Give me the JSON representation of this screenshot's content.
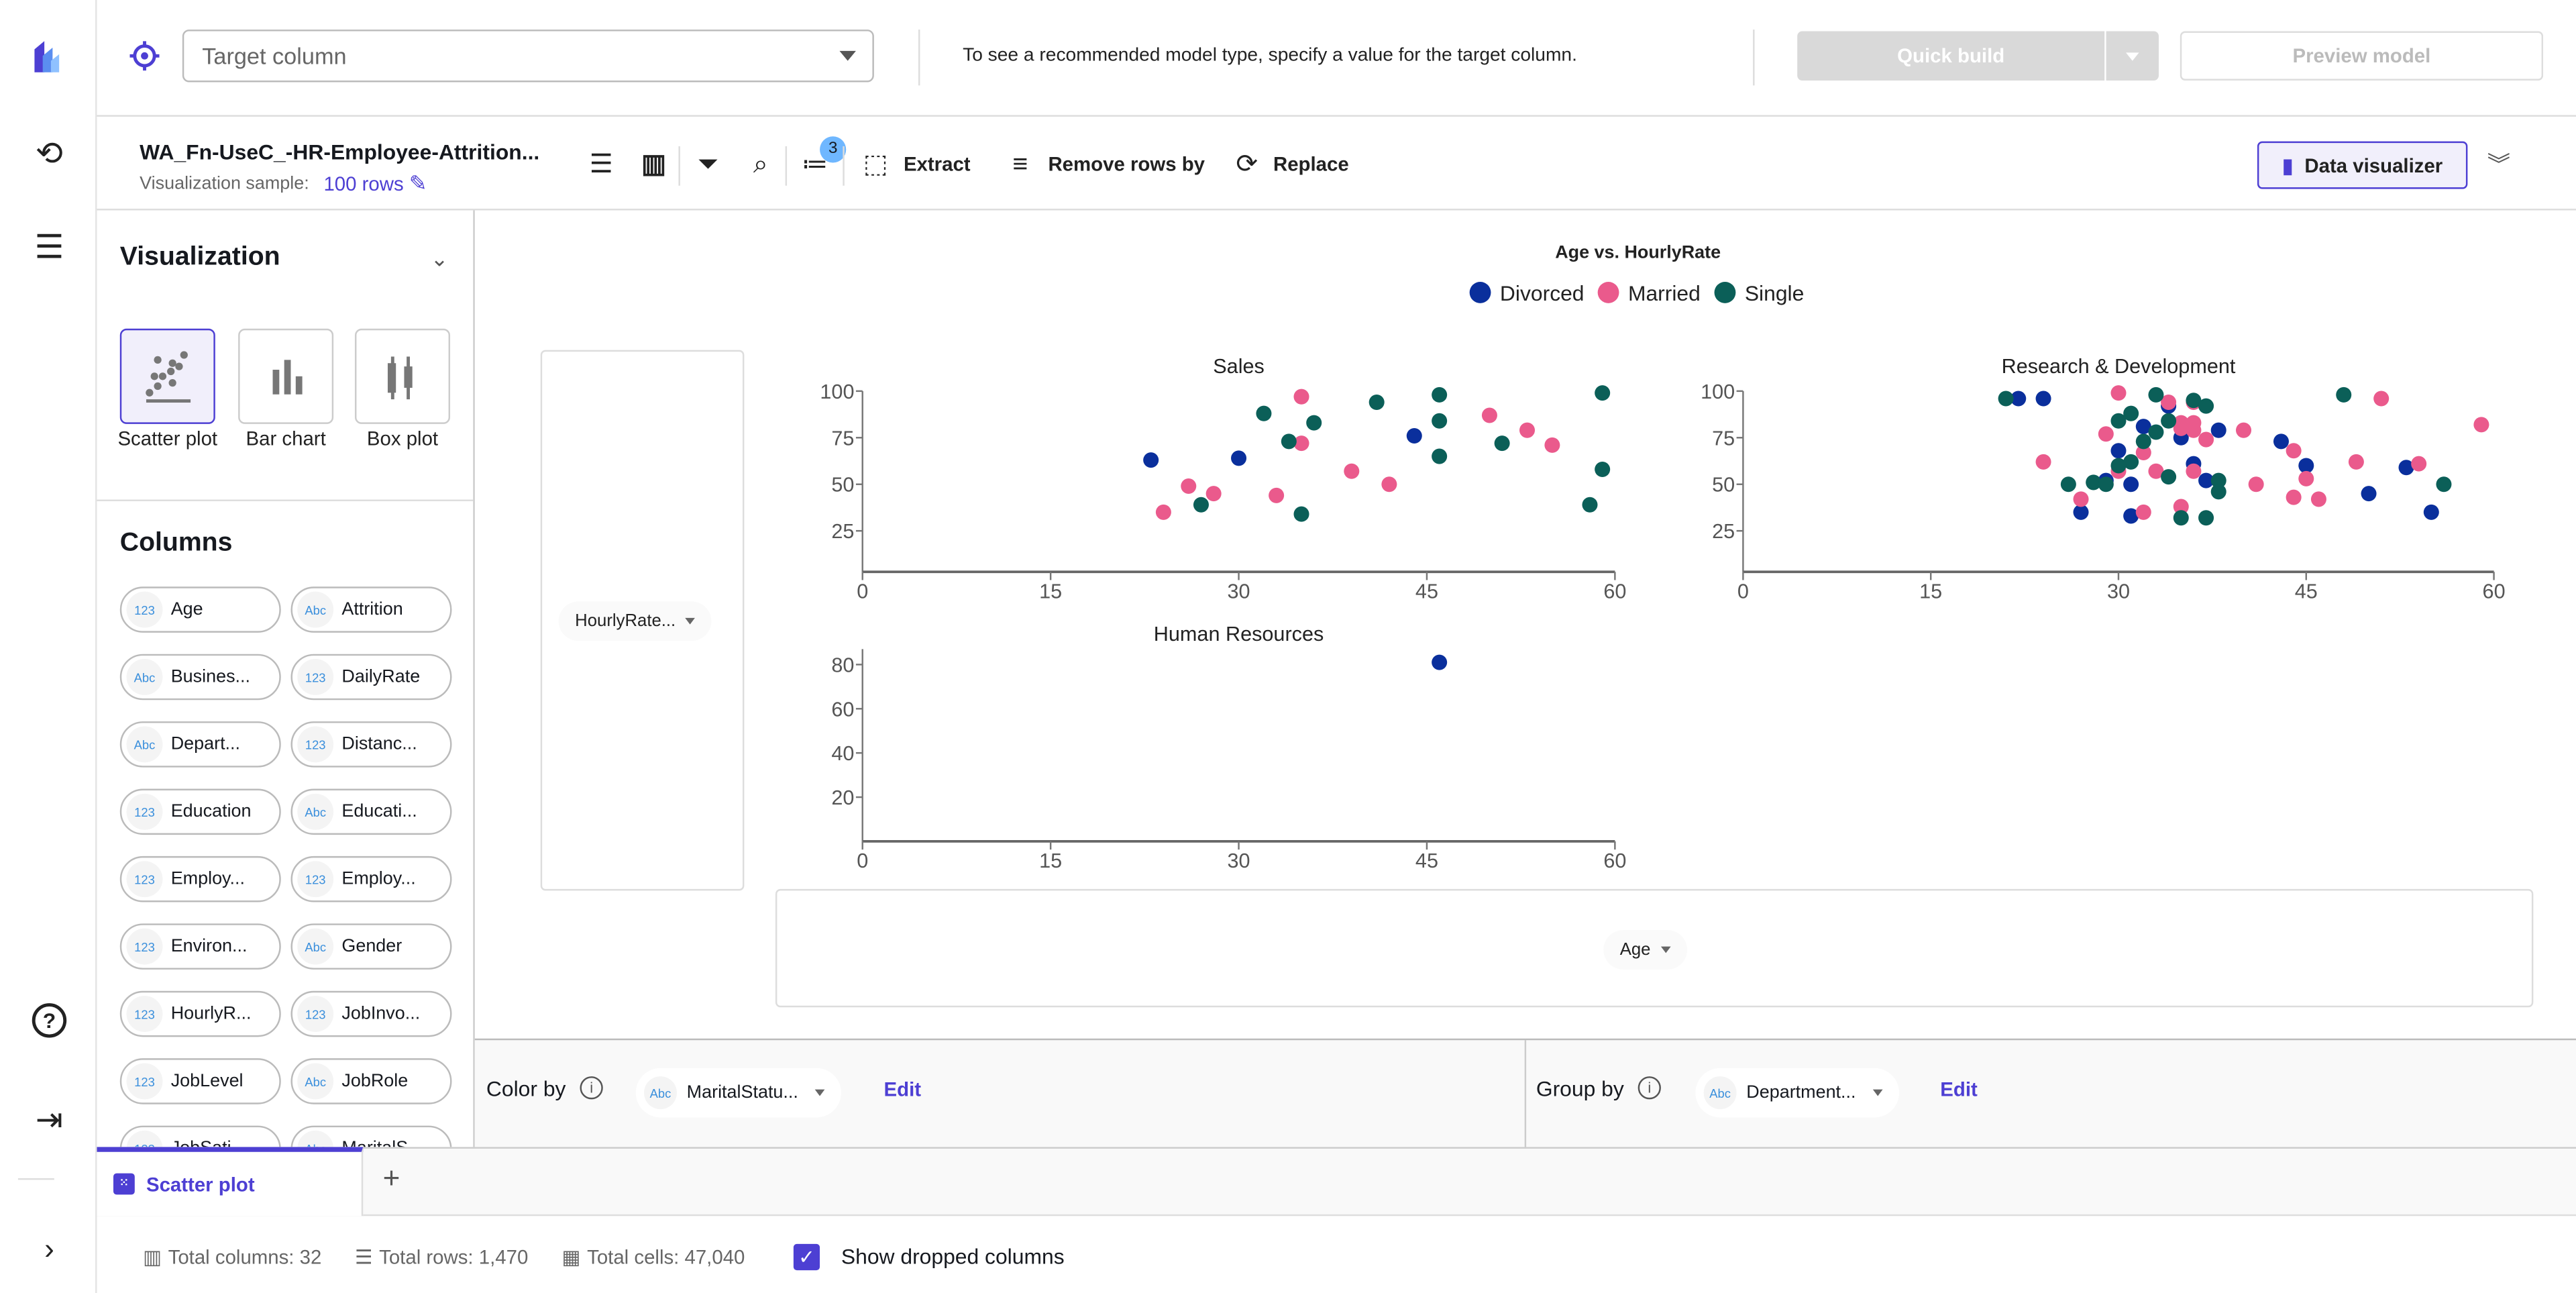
{
  "header": {
    "target_placeholder": "Target column",
    "hint": "To see a recommended model type, specify a value for the target column.",
    "quick_build": "Quick build",
    "preview_model": "Preview model"
  },
  "toolbar": {
    "dataset_title": "WA_Fn-UseC_-HR-Employee-Attrition...",
    "sample_label": "Visualization sample:",
    "sample_value": "100 rows",
    "steps_badge": "3",
    "extract": "Extract",
    "remove_rows": "Remove rows by",
    "replace": "Replace",
    "data_visualizer": "Data visualizer"
  },
  "left_panel": {
    "visualization_title": "Visualization",
    "chart_types": [
      {
        "label": "Scatter plot",
        "selected": true
      },
      {
        "label": "Bar chart",
        "selected": false
      },
      {
        "label": "Box plot",
        "selected": false
      }
    ],
    "columns_title": "Columns",
    "columns": [
      {
        "type": "123",
        "name": "Age"
      },
      {
        "type": "Abc",
        "name": "Attrition"
      },
      {
        "type": "Abc",
        "name": "Busines..."
      },
      {
        "type": "123",
        "name": "DailyRate"
      },
      {
        "type": "Abc",
        "name": "Depart..."
      },
      {
        "type": "123",
        "name": "Distanc..."
      },
      {
        "type": "123",
        "name": "Education"
      },
      {
        "type": "Abc",
        "name": "Educati..."
      },
      {
        "type": "123",
        "name": "Employ..."
      },
      {
        "type": "123",
        "name": "Employ..."
      },
      {
        "type": "123",
        "name": "Environ..."
      },
      {
        "type": "Abc",
        "name": "Gender"
      },
      {
        "type": "123",
        "name": "HourlyR..."
      },
      {
        "type": "123",
        "name": "JobInvo..."
      },
      {
        "type": "123",
        "name": "JobLevel"
      },
      {
        "type": "Abc",
        "name": "JobRole"
      },
      {
        "type": "123",
        "name": "JobSati..."
      },
      {
        "type": "Abc",
        "name": "MaritalS..."
      }
    ]
  },
  "axes_fields": {
    "y_field": "HourlyRate...",
    "x_field": "Age"
  },
  "config": {
    "color_by_label": "Color by",
    "color_by_type": "Abc",
    "color_by_value": "MaritalStatu...",
    "group_by_label": "Group by",
    "group_by_type": "Abc",
    "group_by_value": "Department...",
    "edit": "Edit"
  },
  "tabs": [
    {
      "label": "Scatter plot",
      "active": true
    }
  ],
  "status": {
    "total_columns": "Total columns: 32",
    "total_rows": "Total rows: 1,470",
    "total_cells": "Total cells: 47,040",
    "show_dropped": "Show dropped columns",
    "show_dropped_checked": true
  },
  "colors": {
    "accent": "#4d3fd3",
    "Divorced": "#0a2f9c",
    "Married": "#ea5a8c",
    "Single": "#0b5f58"
  },
  "chart_data": {
    "type": "scatter",
    "title": "Age vs. HourlyRate",
    "legend": [
      "Divorced",
      "Married",
      "Single"
    ],
    "legend_position": "top-center",
    "xlabel": "Age",
    "ylabel": "HourlyRate",
    "subplots": [
      {
        "title": "Sales",
        "xlim": [
          0,
          60
        ],
        "ylim": [
          3,
          100
        ],
        "xticks": [
          "0",
          "15",
          "30",
          "45",
          "60"
        ],
        "yticks": [
          "25",
          "50",
          "75",
          "100"
        ],
        "series": {
          "Divorced": [
            [
              23,
              63
            ],
            [
              30,
              64
            ],
            [
              44,
              76
            ]
          ],
          "Married": [
            [
              35,
              97
            ],
            [
              35,
              72
            ],
            [
              26,
              49
            ],
            [
              28,
              45
            ],
            [
              24,
              35
            ],
            [
              33,
              44
            ],
            [
              39,
              57
            ],
            [
              42,
              50
            ],
            [
              50,
              87
            ],
            [
              53,
              79
            ],
            [
              55,
              71
            ]
          ],
          "Single": [
            [
              32,
              88
            ],
            [
              34,
              73
            ],
            [
              36,
              83
            ],
            [
              41,
              94
            ],
            [
              46,
              98
            ],
            [
              46,
              84
            ],
            [
              46,
              65
            ],
            [
              51,
              72
            ],
            [
              59,
              99
            ],
            [
              59,
              58
            ],
            [
              58,
              39
            ],
            [
              27,
              39
            ],
            [
              35,
              34
            ]
          ]
        }
      },
      {
        "title": "Research & Development",
        "xlim": [
          0,
          60
        ],
        "ylim": [
          3,
          100
        ],
        "xticks": [
          "0",
          "15",
          "30",
          "45",
          "60"
        ],
        "yticks": [
          "25",
          "50",
          "75",
          "100"
        ],
        "series": {
          "Divorced": [
            [
              22,
              96
            ],
            [
              24,
              96
            ],
            [
              34,
              92
            ],
            [
              32,
              81
            ],
            [
              35,
              75
            ],
            [
              38,
              79
            ],
            [
              30,
              68
            ],
            [
              36,
              61
            ],
            [
              29,
              52
            ],
            [
              31,
              50
            ],
            [
              37,
              52
            ],
            [
              43,
              73
            ],
            [
              45,
              60
            ],
            [
              53,
              59
            ],
            [
              50,
              45
            ],
            [
              55,
              35
            ],
            [
              27,
              35
            ],
            [
              31,
              33
            ]
          ],
          "Married": [
            [
              30,
              99
            ],
            [
              34,
              94
            ],
            [
              36,
              94
            ],
            [
              35,
              83
            ],
            [
              36,
              83
            ],
            [
              35,
              80
            ],
            [
              36,
              79
            ],
            [
              29,
              77
            ],
            [
              37,
              74
            ],
            [
              32,
              67
            ],
            [
              24,
              62
            ],
            [
              33,
              57
            ],
            [
              30,
              57
            ],
            [
              36,
              57
            ],
            [
              40,
              79
            ],
            [
              44,
              68
            ],
            [
              49,
              62
            ],
            [
              51,
              96
            ],
            [
              54,
              61
            ],
            [
              59,
              82
            ],
            [
              41,
              50
            ],
            [
              45,
              53
            ],
            [
              44,
              43
            ],
            [
              46,
              42
            ],
            [
              27,
              42
            ],
            [
              35,
              38
            ],
            [
              32,
              35
            ]
          ],
          "Single": [
            [
              21,
              96
            ],
            [
              33,
              98
            ],
            [
              36,
              95
            ],
            [
              37,
              92
            ],
            [
              31,
              88
            ],
            [
              30,
              84
            ],
            [
              34,
              84
            ],
            [
              33,
              78
            ],
            [
              32,
              73
            ],
            [
              31,
              62
            ],
            [
              30,
              60
            ],
            [
              34,
              54
            ],
            [
              28,
              51
            ],
            [
              29,
              50
            ],
            [
              26,
              50
            ],
            [
              38,
              52
            ],
            [
              38,
              46
            ],
            [
              48,
              98
            ],
            [
              56,
              50
            ],
            [
              35,
              32
            ],
            [
              37,
              32
            ]
          ]
        }
      },
      {
        "title": "Human Resources",
        "xlim": [
          0,
          60
        ],
        "ylim": [
          0,
          87
        ],
        "xticks": [
          "0",
          "15",
          "30",
          "45",
          "60"
        ],
        "yticks": [
          "20",
          "40",
          "60",
          "80"
        ],
        "series": {
          "Divorced": [
            [
              46,
              81
            ]
          ],
          "Married": [],
          "Single": []
        }
      }
    ]
  }
}
